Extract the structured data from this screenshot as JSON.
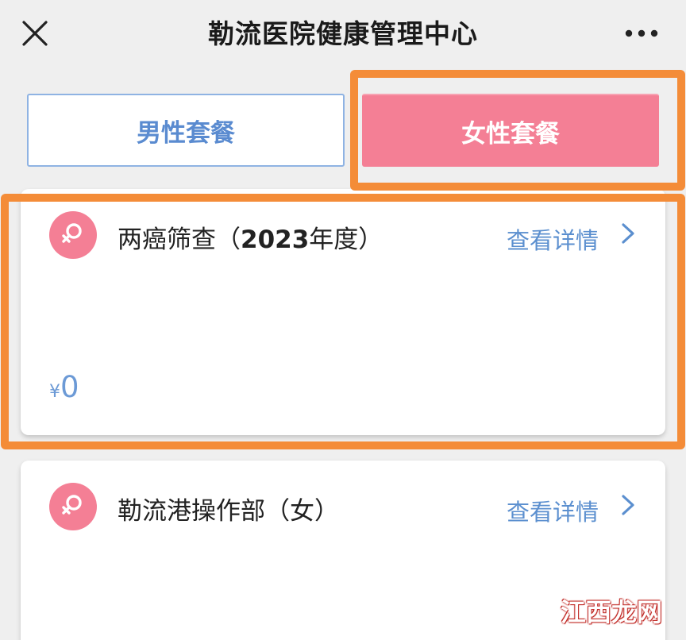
{
  "header": {
    "title": "勒流医院健康管理中心",
    "close_icon": "close-icon",
    "more_icon": "more-dots-icon"
  },
  "tabs": [
    {
      "label": "男性套餐",
      "selected": false
    },
    {
      "label": "女性套餐",
      "selected": true
    }
  ],
  "packages": [
    {
      "icon": "female-symbol-icon",
      "title_prefix": "两癌筛查（",
      "title_year": "2023",
      "title_suffix": "年度）",
      "detail_label": "查看详情",
      "currency": "¥",
      "price": "0"
    },
    {
      "icon": "female-symbol-icon",
      "title": "勒流港操作部（女）",
      "detail_label": "查看详情"
    }
  ],
  "watermark": "江西龙网",
  "colors": {
    "highlight": "#f48c38",
    "female_accent": "#f47f95",
    "male_accent": "#5a8bd0",
    "link": "#5b8fcf"
  }
}
